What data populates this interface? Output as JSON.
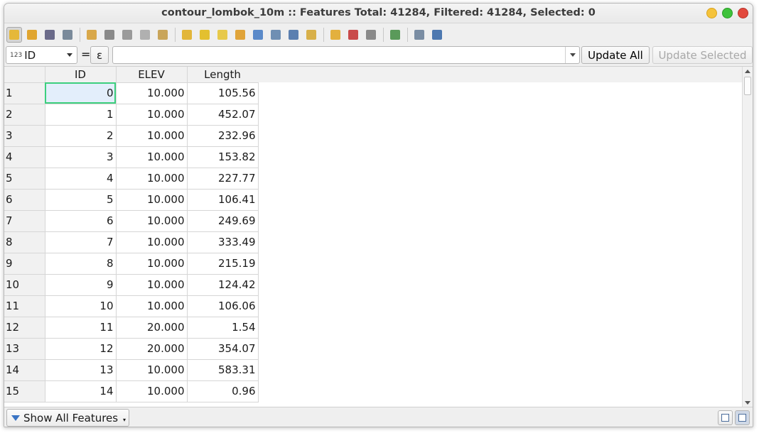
{
  "window": {
    "title": "contour_lombok_10m :: Features Total: 41284, Filtered: 41284, Selected: 0"
  },
  "toolbar": {
    "buttons": [
      {
        "icon": "pencil-edit-icon",
        "color": "#e5b83a",
        "active": true
      },
      {
        "icon": "multi-edit-icon",
        "color": "#e0a530"
      },
      {
        "icon": "save-edits-icon",
        "color": "#6b6b8a"
      },
      {
        "icon": "reload-icon",
        "color": "#7a8a9a"
      },
      {
        "sep": true
      },
      {
        "icon": "add-feature-icon",
        "color": "#d9a84a"
      },
      {
        "icon": "delete-feature-icon",
        "color": "#8a8a8a"
      },
      {
        "icon": "cut-icon",
        "color": "#9a9a9a"
      },
      {
        "icon": "copy-icon",
        "color": "#b0b0b0"
      },
      {
        "icon": "paste-icon",
        "color": "#c9a55a"
      },
      {
        "sep": true
      },
      {
        "icon": "select-expression-icon",
        "color": "#e2b63a"
      },
      {
        "icon": "select-all-icon",
        "color": "#e3c02f"
      },
      {
        "icon": "invert-selection-icon",
        "color": "#e7c94a"
      },
      {
        "icon": "deselect-all-icon",
        "color": "#e0a43a"
      },
      {
        "icon": "filter-icon",
        "color": "#5b8ac9"
      },
      {
        "icon": "move-selection-top-icon",
        "color": "#6f8fb3"
      },
      {
        "icon": "pan-to-selection-icon",
        "color": "#5b7fb0"
      },
      {
        "icon": "zoom-to-selection-icon",
        "color": "#d8b04a"
      },
      {
        "sep": true
      },
      {
        "icon": "new-field-icon",
        "color": "#e3b03e"
      },
      {
        "icon": "delete-field-icon",
        "color": "#c94a4a"
      },
      {
        "icon": "field-calculator-icon",
        "color": "#8a8a8a"
      },
      {
        "sep": true
      },
      {
        "icon": "conditional-formatting-icon",
        "color": "#5a9a5a"
      },
      {
        "sep": true
      },
      {
        "icon": "dock-icon",
        "color": "#7a8da3"
      },
      {
        "icon": "actions-icon",
        "color": "#4d78b0"
      }
    ]
  },
  "filter": {
    "field_prefix": "123",
    "field_value": "ID",
    "equals": "=",
    "epsilon": "ε",
    "expression_value": "",
    "update_all": "Update All",
    "update_selected": "Update Selected"
  },
  "table": {
    "columns": [
      "ID",
      "ELEV",
      "Length"
    ],
    "rows": [
      {
        "n": "1",
        "id": "0",
        "elev": "10.000",
        "length": "105.56"
      },
      {
        "n": "2",
        "id": "1",
        "elev": "10.000",
        "length": "452.07"
      },
      {
        "n": "3",
        "id": "2",
        "elev": "10.000",
        "length": "232.96"
      },
      {
        "n": "4",
        "id": "3",
        "elev": "10.000",
        "length": "153.82"
      },
      {
        "n": "5",
        "id": "4",
        "elev": "10.000",
        "length": "227.77"
      },
      {
        "n": "6",
        "id": "5",
        "elev": "10.000",
        "length": "106.41"
      },
      {
        "n": "7",
        "id": "6",
        "elev": "10.000",
        "length": "249.69"
      },
      {
        "n": "8",
        "id": "7",
        "elev": "10.000",
        "length": "333.49"
      },
      {
        "n": "9",
        "id": "8",
        "elev": "10.000",
        "length": "215.19"
      },
      {
        "n": "10",
        "id": "9",
        "elev": "10.000",
        "length": "124.42"
      },
      {
        "n": "11",
        "id": "10",
        "elev": "10.000",
        "length": "106.06"
      },
      {
        "n": "12",
        "id": "11",
        "elev": "20.000",
        "length": "1.54"
      },
      {
        "n": "13",
        "id": "12",
        "elev": "20.000",
        "length": "354.07"
      },
      {
        "n": "14",
        "id": "13",
        "elev": "10.000",
        "length": "583.31"
      },
      {
        "n": "15",
        "id": "14",
        "elev": "10.000",
        "length": "0.96"
      }
    ]
  },
  "status": {
    "show_all_label": "Show All Features"
  }
}
